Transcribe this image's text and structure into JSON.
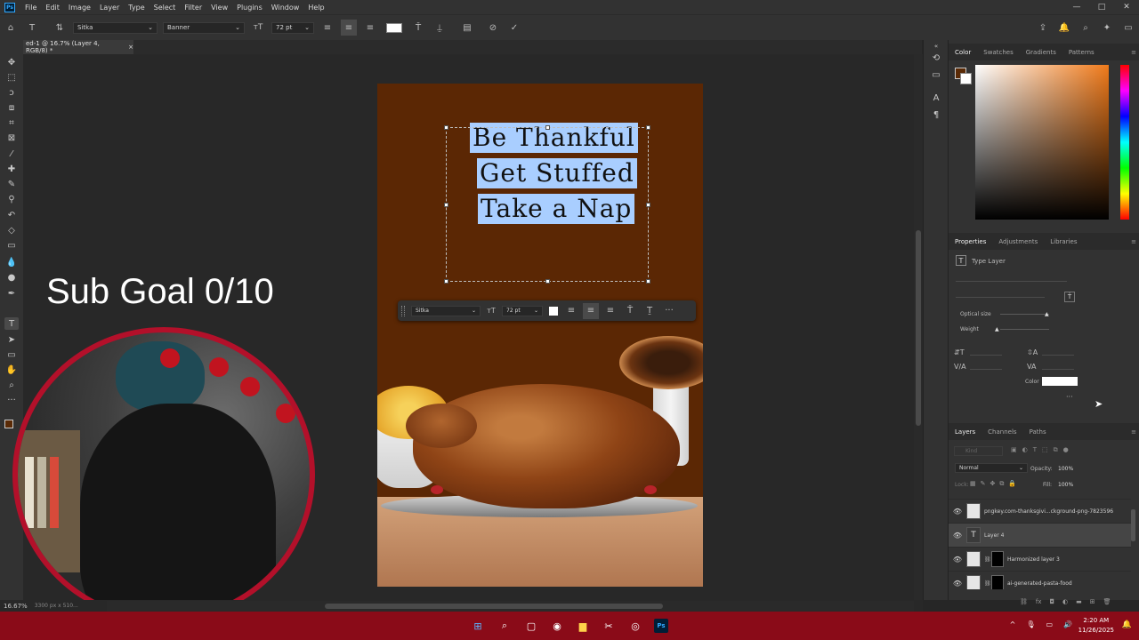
{
  "menubar": {
    "app_logo": "Ps",
    "items": [
      "File",
      "Edit",
      "Image",
      "Layer",
      "Type",
      "Select",
      "Filter",
      "View",
      "Plugins",
      "Window",
      "Help"
    ],
    "window_buttons": [
      "—",
      "□",
      "✕"
    ]
  },
  "options_bar": {
    "font_family": "Sitka",
    "font_style": "Banner",
    "font_size": "72 pt",
    "text_color": "#ffffff"
  },
  "document": {
    "tab_title": "ed-1 @ 16.7% (Layer 4, RGB/8) *",
    "tab_close": "×"
  },
  "poster": {
    "background_color": "#5b2704",
    "lines": [
      "Be Thankful",
      "Get Stuffed",
      "Take a Nap"
    ]
  },
  "context_bar": {
    "font_family": "Sitka",
    "font_size": "72 pt",
    "more": "···"
  },
  "overlay": {
    "sub_goal": "Sub Goal 0/10"
  },
  "color_panel": {
    "tabs": [
      "Color",
      "Swatches",
      "Gradients",
      "Patterns"
    ],
    "active_tab": "Color",
    "foreground_color": "#5a2a06",
    "background_color": "#ffffff"
  },
  "properties_panel": {
    "tabs": [
      "Properties",
      "Adjustments",
      "Libraries"
    ],
    "active_tab": "Properties",
    "layer_type": "Type Layer",
    "optical_size_label": "Optical size",
    "weight_label": "Weight",
    "color_label": "Color",
    "color_value": "#ffffff",
    "more": "···"
  },
  "layers_panel": {
    "tabs": [
      "Layers",
      "Channels",
      "Paths"
    ],
    "active_tab": "Layers",
    "filter_placeholder": "Kind",
    "blend_mode": "Normal",
    "opacity_label": "Opacity:",
    "opacity_value": "100%",
    "lock_label": "Lock:",
    "fill_label": "Fill:",
    "fill_value": "100%",
    "layers": [
      {
        "name": "pngkey.com-thanksgivi...ckground-png-7823596",
        "type": "image",
        "selected": false
      },
      {
        "name": "Layer 4",
        "type": "text",
        "selected": true
      },
      {
        "name": "Harmonized layer 3",
        "type": "image-mask",
        "selected": false
      },
      {
        "name": "ai-generated-pasta-food",
        "type": "image-mask",
        "selected": false
      }
    ]
  },
  "status_bar": {
    "zoom": "16.67%",
    "doc_size": "3300 px x 510..."
  },
  "taskbar": {
    "time": "2:20 AM",
    "date": "11/26/2025",
    "accent": "#8a0b18"
  }
}
